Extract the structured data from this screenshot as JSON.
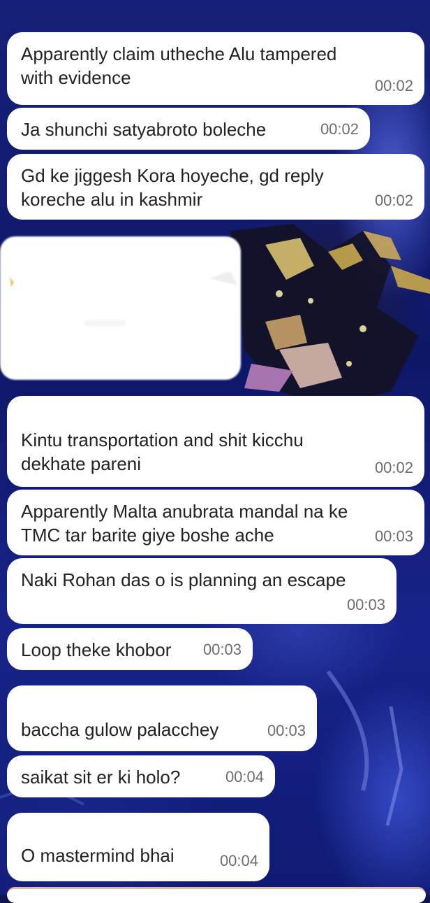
{
  "colors": {
    "bubble": "#ffffff",
    "text": "#222222",
    "time": "#6d6d6d",
    "wallpaper": "#16207a"
  },
  "messages": [
    {
      "text": "Apparently claim utheche Alu tampered\nwith evidence",
      "time": "00:02"
    },
    {
      "text": "Ja shunchi satyabroto boleche",
      "time": "00:02"
    },
    {
      "text": "Gd ke jiggesh Kora hoyeche, gd reply\nkoreche alu in kashmir",
      "time": "00:02"
    },
    {
      "text": "Kintu transportation and shit kicchu\ndekhate pareni",
      "time": "00:02"
    },
    {
      "text": "Apparently Malta anubrata mandal na ke\nTMC tar barite giye boshe ache",
      "time": "00:03"
    },
    {
      "text": "Naki Rohan das o is planning an escape",
      "time": "00:03"
    },
    {
      "text": "Loop theke khobor",
      "time": "00:03"
    },
    {
      "text": "baccha gulow palacchey",
      "time": "00:03"
    },
    {
      "text": "saikat sit er ki holo?",
      "time": "00:04"
    },
    {
      "text": "O mastermind bhai",
      "time": "00:04"
    }
  ],
  "media_placeholder": {
    "icon": "blurred-image-icon"
  }
}
